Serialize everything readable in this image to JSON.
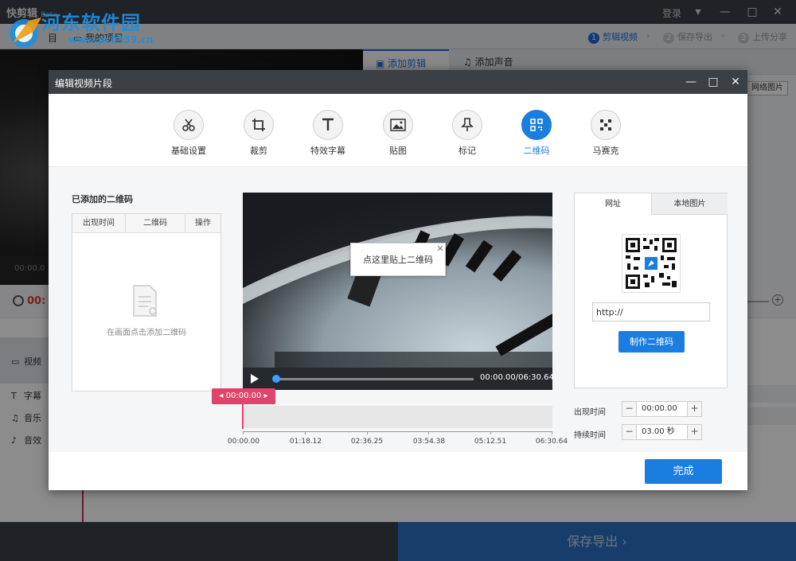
{
  "app": {
    "logo": "快剪辑",
    "logo_beta": "Beta",
    "watermark": "河东软件园",
    "watermark_url": "www.pc0359.cn",
    "login": "登录",
    "toolbar": {
      "project": "目",
      "my_projects": "我的项目"
    },
    "steps": [
      {
        "num": "1",
        "label": "剪辑视频",
        "active": true
      },
      {
        "num": "2",
        "label": "保存导出",
        "active": false
      },
      {
        "num": "3",
        "label": "上传分享",
        "active": false
      }
    ],
    "right_tabs": [
      "添加剪辑",
      "添加声音"
    ],
    "net_image": "网络图片",
    "preview_time": "00:00.0",
    "clock_time": "00:",
    "tracks": [
      "视频",
      "字幕",
      "音乐",
      "音效"
    ],
    "export": "保存导出 ›"
  },
  "dialog": {
    "title": "编辑视频片段",
    "tools": [
      {
        "label": "基础设置",
        "icon": "scissors-icon",
        "active": false
      },
      {
        "label": "裁剪",
        "icon": "crop-icon",
        "active": false
      },
      {
        "label": "特效字幕",
        "icon": "text-icon",
        "active": false
      },
      {
        "label": "贴图",
        "icon": "image-icon",
        "active": false
      },
      {
        "label": "标记",
        "icon": "pin-icon",
        "active": false
      },
      {
        "label": "二维码",
        "icon": "qrcode-icon",
        "active": true
      },
      {
        "label": "马赛克",
        "icon": "mosaic-icon",
        "active": false
      }
    ],
    "added_title": "已添加的二维码",
    "table_headers": [
      "出现时间",
      "二维码",
      "操作"
    ],
    "empty_text": "在画面点击添加二维码",
    "qr_placeholder": "点这里贴上二维码",
    "video_time": "00:00.00/06:30.64",
    "marker_time": "00:00.00",
    "timeline_ticks": [
      "00:00.00",
      "01:18.12",
      "02:36.25",
      "03:54.38",
      "05:12.51",
      "06:30.64"
    ],
    "panel_tabs": [
      "网址",
      "本地图片"
    ],
    "url_value": "http://",
    "make_qr": "制作二维码",
    "appear_label": "出现时间",
    "appear_value": "00:00.00",
    "duration_label": "持续时间",
    "duration_value": "03.00 秒",
    "finish": "完成"
  },
  "colors": {
    "accent": "#1a7de0",
    "marker": "#e0446a",
    "titlebar": "#3b4046"
  }
}
